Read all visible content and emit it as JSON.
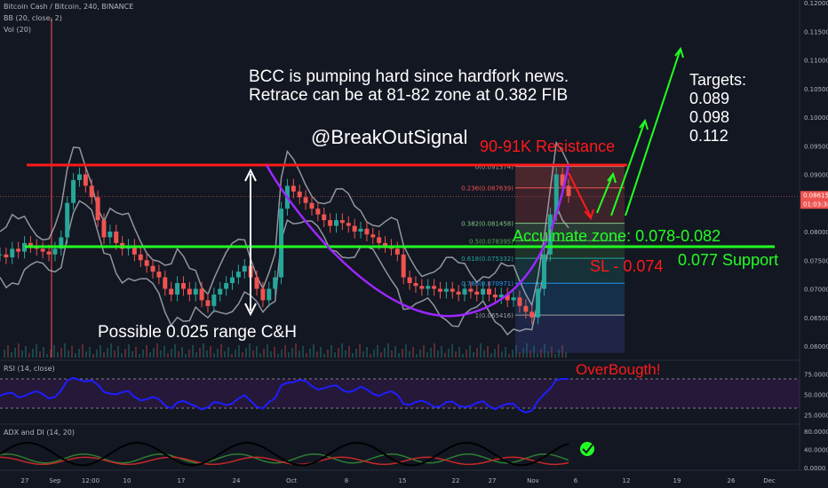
{
  "header": {
    "symbol": "Bitcoin Cash / Bitcoin, 240, BINANCE",
    "bb": "BB (20, close, 2)",
    "vol": "Vol (20)"
  },
  "panes": {
    "rsi_title": "RSI (14, close)",
    "adx_title": "ADX and DI (14, 20)"
  },
  "price_axis": {
    "ticks": [
      "0.120000",
      "0.115000",
      "0.110000",
      "0.105000",
      "0.100000",
      "0.095000",
      "0.090000",
      "0.085000",
      "0.080000",
      "0.075000",
      "0.070000",
      "0.065000",
      "0.060000"
    ],
    "last_price": "0.086155",
    "countdown": "01:03:38",
    "last_price_color": "#ef5350"
  },
  "rsi_axis": {
    "ticks": [
      "75.0000",
      "50.0000",
      "25.0000"
    ]
  },
  "adx_axis": {
    "ticks": [
      "80.0000",
      "40.0000",
      "0.0000"
    ]
  },
  "time_axis": {
    "labels": [
      "27",
      "Sep",
      "12:00",
      "10",
      "17",
      "24",
      "Oct",
      "8",
      "15",
      "22",
      "27",
      "Nov",
      "6",
      "12",
      "19",
      "26",
      "Dec"
    ]
  },
  "annotations": {
    "headline1": "BCC is pumping hard since hardfork news.",
    "headline2": "Retrace can be at 81-82 zone at 0.382 FIB",
    "handle": "@BreakOutSignal",
    "resistance": "90-91K Resistance",
    "accumulate": "Acculmate zone: 0.078-0.082",
    "support": "0.077 Support",
    "stoploss": "SL - 0.074",
    "range": "Possible 0.025 range C&H",
    "targets_title": "Targets:",
    "target1": "0.089",
    "target2": "0.098",
    "target3": "0.112",
    "overbought": "OverBougth!"
  },
  "fib_levels": [
    {
      "label": "0(0.091374)",
      "price": 0.091374,
      "color": "#9e9e9e"
    },
    {
      "label": "0.236(0.087639)",
      "price": 0.087639,
      "color": "#ef5350"
    },
    {
      "label": "0.382(0.081458)",
      "price": 0.081458,
      "color": "#81c784"
    },
    {
      "label": "0.5(0.078395)",
      "price": 0.078395,
      "color": "#4caf50"
    },
    {
      "label": "0.618(0.075332)",
      "price": 0.075332,
      "color": "#26a69a"
    },
    {
      "label": "0.786(0.070971)",
      "price": 0.070971,
      "color": "#2196f3"
    },
    {
      "label": "1(0.065416)",
      "price": 0.065416,
      "color": "#9e9e9e"
    }
  ],
  "colors": {
    "up": "#26a69a",
    "down": "#ef5350",
    "bb": "#b2b5be",
    "rsi": "#1e1eff",
    "resistance": "#ff1a1a",
    "support": "#22ff22",
    "cup": "#9c27ff",
    "targets": "#22ff22",
    "adx": "#000000",
    "di_plus": "#2e7d32",
    "di_minus": "#c62828"
  },
  "chart_data": {
    "type": "line",
    "title": "Bitcoin Cash / Bitcoin, 240, BINANCE",
    "ylabel": "",
    "xlabel": "",
    "ylim": [
      0.058,
      0.12
    ],
    "series": [
      {
        "values": [
          0.076,
          0.0755,
          0.077,
          0.0765,
          0.078,
          0.0775,
          0.077,
          0.0765,
          0.076,
          0.077,
          0.079,
          0.085,
          0.089,
          0.09,
          0.088,
          0.086,
          0.082,
          0.079,
          0.08,
          0.078,
          0.077,
          0.0775,
          0.076,
          0.075,
          0.074,
          0.073,
          0.072,
          0.07,
          0.069,
          0.071,
          0.07,
          0.069,
          0.07,
          0.068,
          0.067,
          0.069,
          0.07,
          0.071,
          0.072,
          0.073,
          0.074,
          0.072,
          0.07,
          0.068,
          0.07,
          0.072,
          0.084,
          0.088,
          0.087,
          0.086,
          0.085,
          0.084,
          0.083,
          0.082,
          0.081,
          0.082,
          0.0815,
          0.081,
          0.08,
          0.0805,
          0.0795,
          0.079,
          0.078,
          0.0775,
          0.077,
          0.076,
          0.072,
          0.071,
          0.0705,
          0.07,
          0.0705,
          0.07,
          0.0695,
          0.07,
          0.0695,
          0.069,
          0.07,
          0.0695,
          0.069,
          0.07,
          0.069,
          0.0685,
          0.069,
          0.068,
          0.0685,
          0.067,
          0.066,
          0.065,
          0.07,
          0.076,
          0.083,
          0.09,
          0.088,
          0.0862
        ]
      }
    ]
  }
}
